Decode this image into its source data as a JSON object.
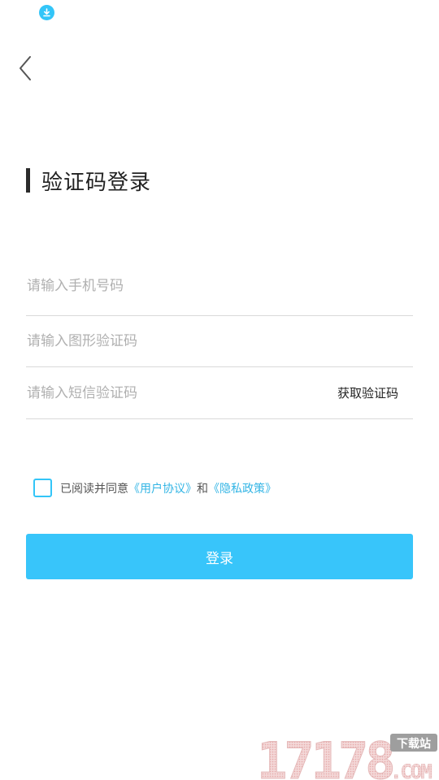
{
  "status_bar": {
    "icon": "download-icon",
    "accent": "#33c5f8"
  },
  "nav": {
    "back_icon": "chevron-left-icon"
  },
  "page": {
    "title": "验证码登录"
  },
  "form": {
    "phone": {
      "placeholder": "请输入手机号码",
      "value": ""
    },
    "image_code": {
      "placeholder": "请输入图形验证码",
      "value": ""
    },
    "sms_code": {
      "placeholder": "请输入短信验证码",
      "value": ""
    },
    "get_code_label": "获取验证码"
  },
  "agreement": {
    "checked": false,
    "prefix": "已阅读并同意",
    "user_agreement": "《用户协议》",
    "conjunction": "和",
    "privacy_policy": "《隐私政策》"
  },
  "login_button": {
    "label": "登录",
    "color": "#38c5fa"
  },
  "watermark": {
    "number": "17178",
    "suffix": ".COM",
    "badge": "下载站"
  }
}
